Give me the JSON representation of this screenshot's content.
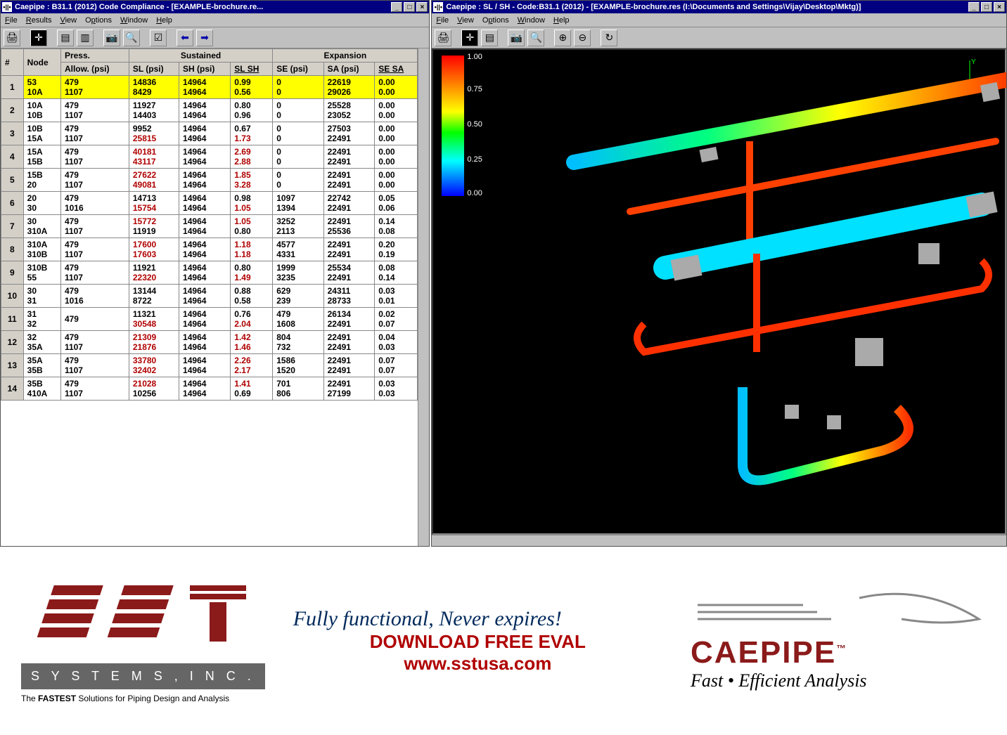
{
  "left": {
    "title": "Caepipe : B31.1 (2012) Code Compliance -   [EXAMPLE-brochure.re...",
    "menus": [
      "File",
      "Results",
      "View",
      "Options",
      "Window",
      "Help"
    ]
  },
  "right": {
    "title": "Caepipe : SL / SH - Code:B31.1 (2012) -   [EXAMPLE-brochure.res (I:\\Documents and Settings\\Vijay\\Desktop\\Mktg)]",
    "menus": [
      "File",
      "View",
      "Options",
      "Window",
      "Help"
    ]
  },
  "headers": {
    "num": "#",
    "node": "Node",
    "press": "Press.",
    "allow": "Allow. (psi)",
    "sustained": "Sustained",
    "expansion": "Expansion",
    "sl": "SL (psi)",
    "sh": "SH (psi)",
    "slsh": "SL SH",
    "se": "SE (psi)",
    "sa": "SA (psi)",
    "sesa": "SE SA"
  },
  "rows": [
    {
      "n": "1",
      "hl": true,
      "a": [
        "53",
        "479",
        "14836",
        "14964",
        "0.99",
        "0",
        "22619",
        "0.00"
      ],
      "b": [
        "10A",
        "1107",
        "8429",
        "14964",
        "0.56",
        "0",
        "29026",
        "0.00"
      ],
      "red": []
    },
    {
      "n": "2",
      "a": [
        "10A",
        "479",
        "11927",
        "14964",
        "0.80",
        "0",
        "25528",
        "0.00"
      ],
      "b": [
        "10B",
        "1107",
        "14403",
        "14964",
        "0.96",
        "0",
        "23052",
        "0.00"
      ],
      "red": []
    },
    {
      "n": "3",
      "a": [
        "10B",
        "479",
        "9952",
        "14964",
        "0.67",
        "0",
        "27503",
        "0.00"
      ],
      "b": [
        "15A",
        "1107",
        "25815",
        "14964",
        "1.73",
        "0",
        "22491",
        "0.00"
      ],
      "red": [
        "b2",
        "b4"
      ]
    },
    {
      "n": "4",
      "a": [
        "15A",
        "479",
        "40181",
        "14964",
        "2.69",
        "0",
        "22491",
        "0.00"
      ],
      "b": [
        "15B",
        "1107",
        "43117",
        "14964",
        "2.88",
        "0",
        "22491",
        "0.00"
      ],
      "red": [
        "a2",
        "a4",
        "b2",
        "b4"
      ]
    },
    {
      "n": "5",
      "a": [
        "15B",
        "479",
        "27622",
        "14964",
        "1.85",
        "0",
        "22491",
        "0.00"
      ],
      "b": [
        "20",
        "1107",
        "49081",
        "14964",
        "3.28",
        "0",
        "22491",
        "0.00"
      ],
      "red": [
        "a2",
        "a4",
        "b2",
        "b4"
      ]
    },
    {
      "n": "6",
      "a": [
        "20",
        "479",
        "14713",
        "14964",
        "0.98",
        "1097",
        "22742",
        "0.05"
      ],
      "b": [
        "30",
        "1016",
        "15754",
        "14964",
        "1.05",
        "1394",
        "22491",
        "0.06"
      ],
      "red": [
        "b2",
        "b4"
      ]
    },
    {
      "n": "7",
      "a": [
        "30",
        "479",
        "15772",
        "14964",
        "1.05",
        "3252",
        "22491",
        "0.14"
      ],
      "b": [
        "310A",
        "1107",
        "11919",
        "14964",
        "0.80",
        "2113",
        "25536",
        "0.08"
      ],
      "red": [
        "a2",
        "a4"
      ]
    },
    {
      "n": "8",
      "a": [
        "310A",
        "479",
        "17600",
        "14964",
        "1.18",
        "4577",
        "22491",
        "0.20"
      ],
      "b": [
        "310B",
        "1107",
        "17603",
        "14964",
        "1.18",
        "4331",
        "22491",
        "0.19"
      ],
      "red": [
        "a2",
        "a4",
        "b2",
        "b4"
      ]
    },
    {
      "n": "9",
      "a": [
        "310B",
        "479",
        "11921",
        "14964",
        "0.80",
        "1999",
        "25534",
        "0.08"
      ],
      "b": [
        "55",
        "1107",
        "22320",
        "14964",
        "1.49",
        "3235",
        "22491",
        "0.14"
      ],
      "red": [
        "b2",
        "b4"
      ]
    },
    {
      "n": "10",
      "a": [
        "30",
        "479",
        "13144",
        "14964",
        "0.88",
        "629",
        "24311",
        "0.03"
      ],
      "b": [
        "31",
        "1016",
        "8722",
        "14964",
        "0.58",
        "239",
        "28733",
        "0.01"
      ],
      "red": []
    },
    {
      "n": "11",
      "a": [
        "31",
        "479",
        "11321",
        "14964",
        "0.76",
        "479",
        "26134",
        "0.02"
      ],
      "b": [
        "32",
        "",
        "30548",
        "14964",
        "2.04",
        "1608",
        "22491",
        "0.07"
      ],
      "red": [
        "b2",
        "b4"
      ]
    },
    {
      "n": "12",
      "a": [
        "32",
        "479",
        "21309",
        "14964",
        "1.42",
        "804",
        "22491",
        "0.04"
      ],
      "b": [
        "35A",
        "1107",
        "21876",
        "14964",
        "1.46",
        "732",
        "22491",
        "0.03"
      ],
      "red": [
        "a2",
        "a4",
        "b2",
        "b4"
      ]
    },
    {
      "n": "13",
      "a": [
        "35A",
        "479",
        "33780",
        "14964",
        "2.26",
        "1586",
        "22491",
        "0.07"
      ],
      "b": [
        "35B",
        "1107",
        "32402",
        "14964",
        "2.17",
        "1520",
        "22491",
        "0.07"
      ],
      "red": [
        "a2",
        "a4",
        "b2",
        "b4"
      ]
    },
    {
      "n": "14",
      "a": [
        "35B",
        "479",
        "21028",
        "14964",
        "1.41",
        "701",
        "22491",
        "0.03"
      ],
      "b": [
        "410A",
        "1107",
        "10256",
        "14964",
        "0.69",
        "806",
        "27199",
        "0.03"
      ],
      "red": [
        "a2",
        "a4"
      ]
    }
  ],
  "legend": {
    "t100": "1.00",
    "t075": "0.75",
    "t050": "0.50",
    "t025": "0.25",
    "t000": "0.00"
  },
  "promo": {
    "sst": "S Y S T E M S , I N C .",
    "sst_tag_pre": "The ",
    "sst_tag_b": "FASTEST",
    "sst_tag_post": " Solutions for Piping Design and Analysis",
    "l1": "Fully functional, Never expires!",
    "l2": "DOWNLOAD FREE EVAL",
    "l3": "www.sstusa.com",
    "caepipe": "CAEPIPE",
    "tm": "™",
    "ctag": "Fast • Efficient Analysis"
  }
}
